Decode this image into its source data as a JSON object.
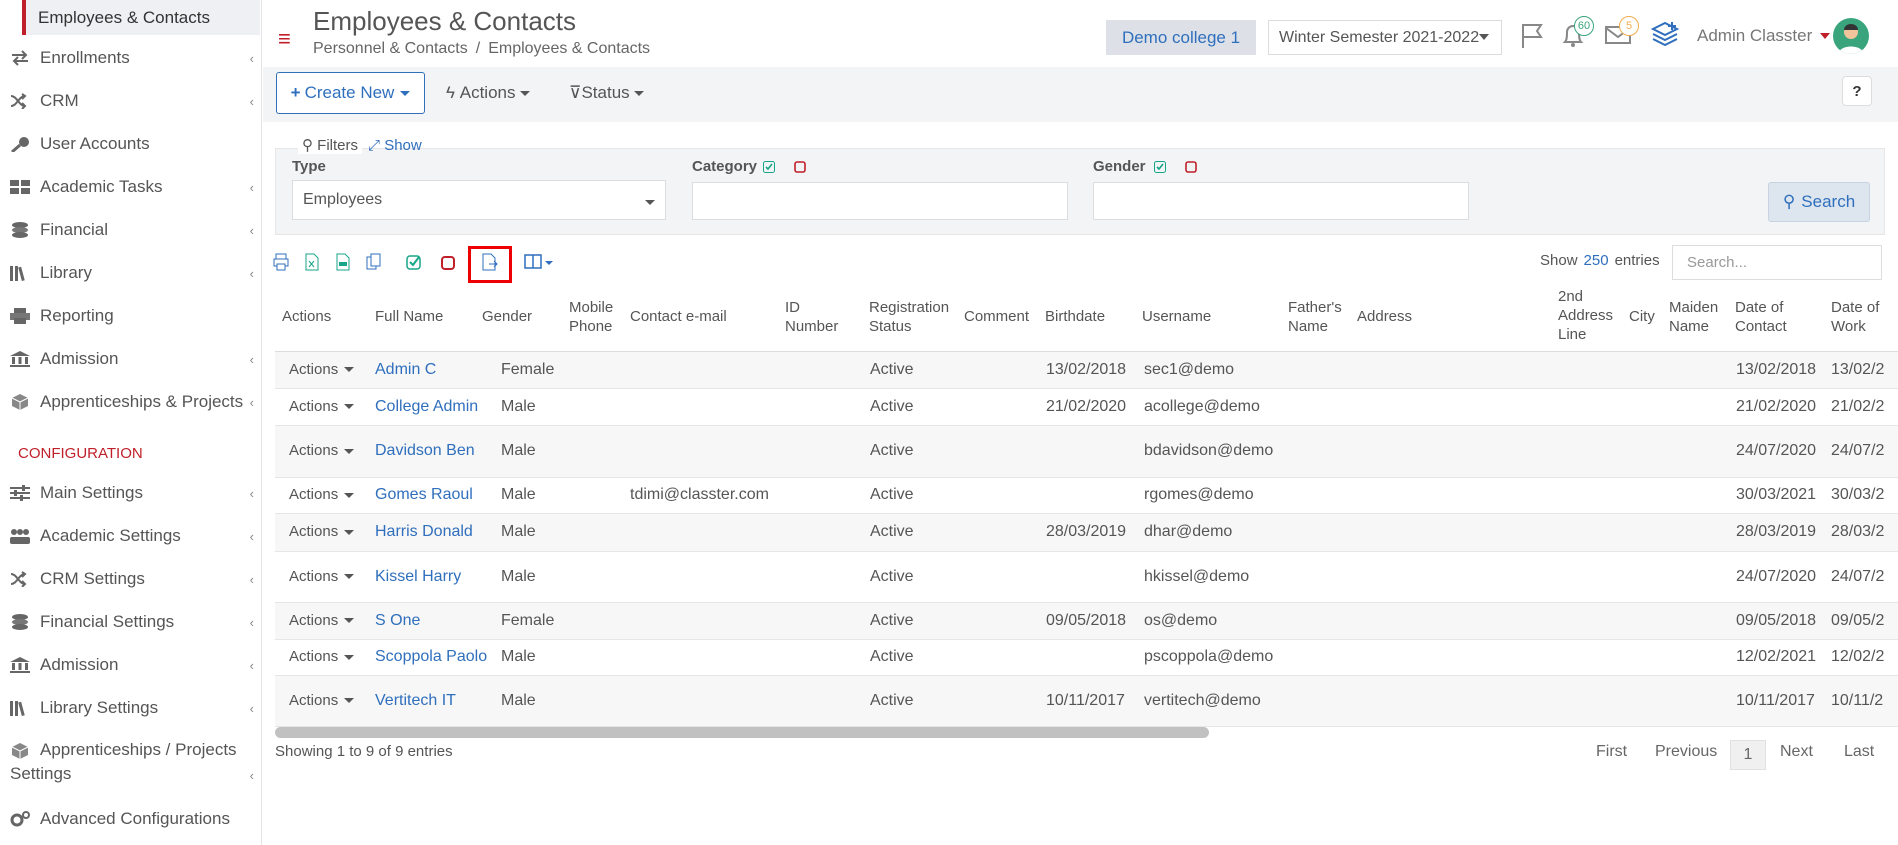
{
  "sidebar": {
    "active_item": "Employees & Contacts",
    "items": [
      {
        "label": "Enrollments",
        "icon": "arrows-exchange-icon",
        "chevron": true
      },
      {
        "label": "CRM",
        "icon": "shuffle-icon",
        "chevron": true
      },
      {
        "label": "User Accounts",
        "icon": "key-icon",
        "chevron": false
      },
      {
        "label": "Academic Tasks",
        "icon": "grid-icon",
        "chevron": true
      },
      {
        "label": "Financial",
        "icon": "coins-icon",
        "chevron": true
      },
      {
        "label": "Library",
        "icon": "books-icon",
        "chevron": true
      },
      {
        "label": "Reporting",
        "icon": "printer-icon",
        "chevron": false
      },
      {
        "label": "Admission",
        "icon": "institution-icon",
        "chevron": true
      },
      {
        "label": "Apprenticeships & Projects",
        "icon": "cube-icon",
        "chevron": true
      }
    ],
    "section_label": "CONFIGURATION",
    "config_items": [
      {
        "label": "Main Settings",
        "icon": "sliders-icon",
        "chevron": true
      },
      {
        "label": "Academic Settings",
        "icon": "users-icon",
        "chevron": true
      },
      {
        "label": "CRM Settings",
        "icon": "shuffle-icon",
        "chevron": true
      },
      {
        "label": "Financial Settings",
        "icon": "coins-icon",
        "chevron": true
      },
      {
        "label": "Admission",
        "icon": "institution-icon",
        "chevron": true
      },
      {
        "label": "Library Settings",
        "icon": "books-icon",
        "chevron": true
      },
      {
        "label_line1": "Apprenticeships / Projects",
        "label_line2": "Settings",
        "icon": "cube-icon",
        "chevron": true
      },
      {
        "label": "Advanced Configurations",
        "icon": "gears-icon",
        "chevron": false
      }
    ]
  },
  "header": {
    "title": "Employees & Contacts",
    "breadcrumb": [
      "Personnel & Contacts",
      "/",
      "Employees & Contacts"
    ],
    "college": "Demo college 1",
    "semester": "Winter Semester 2021-2022",
    "notifications_count": "60",
    "messages_count": "5",
    "user_name": "Admin Classter"
  },
  "toolbar": {
    "create_label": "Create New",
    "actions_label": "Actions",
    "status_label": "Status",
    "help_label": "?"
  },
  "filters": {
    "title": "Filters",
    "show_label": "Show",
    "type_label": "Type",
    "type_value": "Employees",
    "category_label": "Category",
    "gender_label": "Gender",
    "search_label": "Search"
  },
  "table_tools": {
    "show_label": "Show",
    "entries_count": "250",
    "entries_label": "entries",
    "search_placeholder": "Search..."
  },
  "table": {
    "columns": {
      "actions": "Actions",
      "full_name": "Full Name",
      "gender": "Gender",
      "mobile_1": "Mobile",
      "mobile_2": "Phone",
      "email": "Contact e-mail",
      "id_1": "ID",
      "id_2": "Number",
      "reg_1": "Registration",
      "reg_2": "Status",
      "comment": "Comment",
      "birthdate": "Birthdate",
      "username": "Username",
      "father_1": "Father's",
      "father_2": "Name",
      "address": "Address",
      "addr2_1": "2nd",
      "addr2_2": "Address",
      "addr2_3": "Line",
      "city": "City",
      "maiden_1": "Maiden",
      "maiden_2": "Name",
      "doc_1": "Date of",
      "doc_2": "Contact",
      "dow_1": "Date of",
      "dow_2": "Work"
    },
    "rows": [
      {
        "action": "Actions",
        "name": "Admin C",
        "gender": "Female",
        "email": "",
        "status": "Active",
        "birthdate": "13/02/2018",
        "username": "sec1@demo",
        "date_contact": "13/02/2018",
        "date_work": "13/02/2"
      },
      {
        "action": "Actions",
        "name": "College Admin",
        "gender": "Male",
        "email": "",
        "status": "Active",
        "birthdate": "21/02/2020",
        "username": "acollege@demo",
        "date_contact": "21/02/2020",
        "date_work": "21/02/2"
      },
      {
        "action": "Actions",
        "name": "Davidson Ben",
        "gender": "Male",
        "email": "",
        "status": "Active",
        "birthdate": "",
        "username": "bdavidson@demo",
        "date_contact": "24/07/2020",
        "date_work": "24/07/2"
      },
      {
        "action": "Actions",
        "name": "Gomes Raoul",
        "gender": "Male",
        "email": "tdimi@classter.com",
        "status": "Active",
        "birthdate": "",
        "username": "rgomes@demo",
        "date_contact": "30/03/2021",
        "date_work": "30/03/2"
      },
      {
        "action": "Actions",
        "name": "Harris Donald",
        "gender": "Male",
        "email": "",
        "status": "Active",
        "birthdate": "28/03/2019",
        "username": "dhar@demo",
        "date_contact": "28/03/2019",
        "date_work": "28/03/2"
      },
      {
        "action": "Actions",
        "name": "Kissel Harry",
        "gender": "Male",
        "email": "",
        "status": "Active",
        "birthdate": "",
        "username": "hkissel@demo",
        "date_contact": "24/07/2020",
        "date_work": "24/07/2"
      },
      {
        "action": "Actions",
        "name": "S One",
        "gender": "Female",
        "email": "",
        "status": "Active",
        "birthdate": "09/05/2018",
        "username": "os@demo",
        "date_contact": "09/05/2018",
        "date_work": "09/05/2"
      },
      {
        "action": "Actions",
        "name": "Scoppola Paolo",
        "gender": "Male",
        "email": "",
        "status": "Active",
        "birthdate": "",
        "username": "pscoppola@demo",
        "date_contact": "12/02/2021",
        "date_work": "12/02/2"
      },
      {
        "action": "Actions",
        "name": "Vertitech IT",
        "gender": "Male",
        "email": "",
        "status": "Active",
        "birthdate": "10/11/2017",
        "username": "vertitech@demo",
        "date_contact": "10/11/2017",
        "date_work": "10/11/2"
      }
    ]
  },
  "footer": {
    "showing": "Showing 1 to 9 of 9 entries",
    "first": "First",
    "previous": "Previous",
    "page": "1",
    "next": "Next",
    "last": "Last"
  },
  "colors": {
    "accent_red": "#c0202a",
    "link_blue": "#2f6fbd",
    "check_green": "#17a589"
  }
}
